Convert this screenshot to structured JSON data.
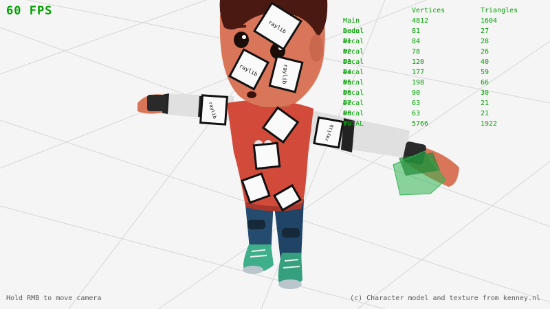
{
  "hud": {
    "fps": "60 FPS",
    "help": "Hold RMB to move camera",
    "credit": "(c) Character model and texture from kenney.nl"
  },
  "stats": {
    "headers": [
      "",
      "Vertices",
      "Triangles"
    ],
    "rows": [
      [
        "Main model",
        "4812",
        "1604"
      ],
      [
        "Decal #1",
        "81",
        "27"
      ],
      [
        "Decal #2",
        "84",
        "28"
      ],
      [
        "Decal #3",
        "78",
        "26"
      ],
      [
        "Decal #4",
        "120",
        "40"
      ],
      [
        "Decal #5",
        "177",
        "59"
      ],
      [
        "Decal #6",
        "198",
        "66"
      ],
      [
        "Decal #7",
        "90",
        "30"
      ],
      [
        "Decal #8",
        "63",
        "21"
      ],
      [
        "Decal #9",
        "63",
        "21"
      ],
      [
        "TOTAL",
        "5766",
        "1922"
      ]
    ]
  },
  "decal_text": "raylib",
  "colors": {
    "hud_green": "#00a000",
    "background": "#f5f5f5",
    "grid": "#d8d8d8",
    "skin": "#d9765a",
    "hair": "#4a1a12",
    "shirt": "#d24a3a",
    "pants": "#254c6e",
    "shoes": "#3fae8a",
    "cursor_cube": "#2fb450"
  }
}
